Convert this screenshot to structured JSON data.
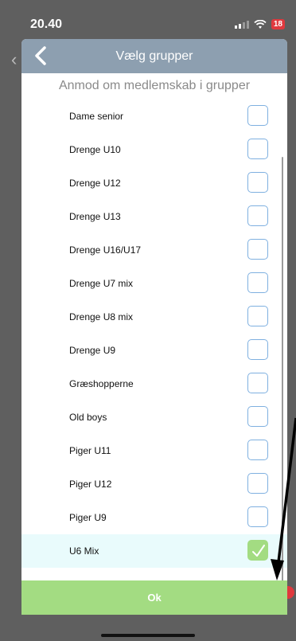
{
  "status_bar": {
    "time": "20.40",
    "battery": "18"
  },
  "modal": {
    "title": "Vælg grupper",
    "subtitle": "Anmod om medlemskab i grupper",
    "groups": [
      {
        "label": "Dame senior",
        "checked": false
      },
      {
        "label": "Drenge U10",
        "checked": false
      },
      {
        "label": "Drenge U12",
        "checked": false
      },
      {
        "label": "Drenge U13",
        "checked": false
      },
      {
        "label": "Drenge U16/U17",
        "checked": false
      },
      {
        "label": "Drenge U7 mix",
        "checked": false
      },
      {
        "label": "Drenge U8 mix",
        "checked": false
      },
      {
        "label": "Drenge U9",
        "checked": false
      },
      {
        "label": "Græshopperne",
        "checked": false
      },
      {
        "label": "Old boys",
        "checked": false
      },
      {
        "label": "Piger U11",
        "checked": false
      },
      {
        "label": "Piger U12",
        "checked": false
      },
      {
        "label": "Piger U9",
        "checked": false
      },
      {
        "label": "U6 Mix",
        "checked": true
      }
    ],
    "ok_label": "Ok"
  },
  "colors": {
    "header": "#8d9fb0",
    "accent_green": "#a3dc82",
    "checkbox_border": "#7fb0e0",
    "selected_row": "#e9fbfc"
  },
  "icons": {
    "back": "chevron-left-icon",
    "check": "checkmark-icon"
  }
}
